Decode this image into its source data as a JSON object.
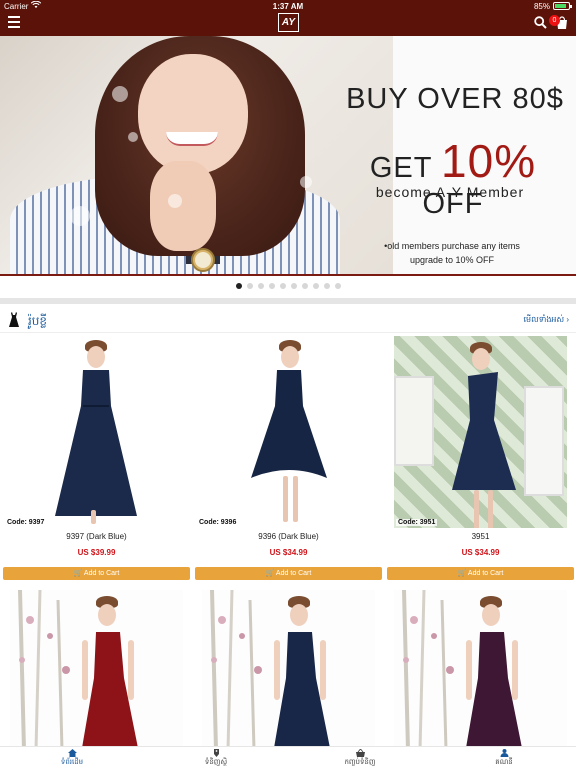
{
  "status_bar": {
    "carrier": "Carrier",
    "time": "1:37 AM",
    "battery": "85%",
    "battery_level": 0.85
  },
  "header": {
    "logo": "AY",
    "cart_count": "0",
    "icons": [
      "menu-icon",
      "search-icon",
      "cart-icon"
    ]
  },
  "banner": {
    "line1": "BUY OVER 80$",
    "line2_pre": "GET ",
    "line2_pct": "10%",
    "line2_post": " OFF",
    "line3": "become A-Y Member",
    "line4a": "•old members purchase any items",
    "line4b": "upgrade to 10% OFF",
    "slide_count": 10,
    "active_slide": 1
  },
  "section": {
    "title": "រ៉ូបខ្លី",
    "see_all": "មើលទាំងអស់ ›"
  },
  "products": [
    {
      "code": "Code: 9397",
      "name": "9397 (Dark Blue)",
      "price": "US $39.99",
      "add": "Add to Cart"
    },
    {
      "code": "Code: 9396",
      "name": "9396 (Dark Blue)",
      "price": "US $34.99",
      "add": "Add to Cart"
    },
    {
      "code": "Code: 3951",
      "name": "3951",
      "price": "US $34.99",
      "add": "Add to Cart"
    }
  ],
  "tabs": [
    {
      "label": "ទំព័រដើម",
      "icon": "home-icon",
      "active": true
    },
    {
      "label": "ទំនិញស្ថិ",
      "icon": "tag-icon",
      "active": false
    },
    {
      "label": "កញ្ចប់ទំនិញ",
      "icon": "basket-icon",
      "active": false
    },
    {
      "label": "គណនី",
      "icon": "user-icon",
      "active": false
    }
  ],
  "colors": {
    "header_bg": "#5b1208",
    "accent_red": "#a21a14",
    "price_red": "#d0141a",
    "button_orange": "#e8a43a",
    "link_blue": "#1a5a9c"
  }
}
